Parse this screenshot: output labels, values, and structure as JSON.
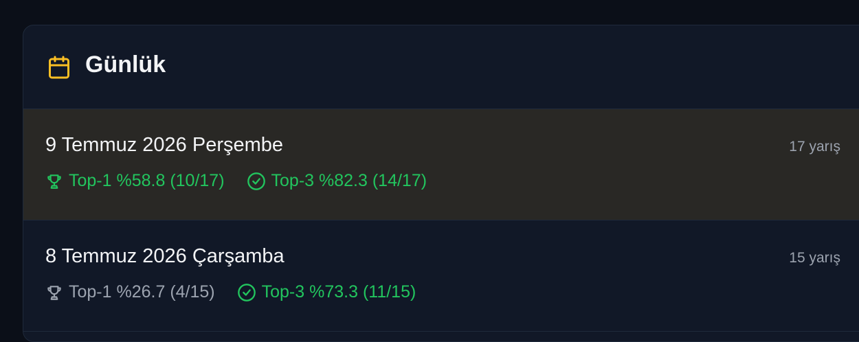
{
  "colors": {
    "accent": "#fbbf24",
    "success": "#22c55e",
    "muted": "#9ca3af",
    "highlight_row": "#292825",
    "card_bg": "#111827"
  },
  "header": {
    "icon": "calendar-icon",
    "title": "Günlük"
  },
  "days": [
    {
      "date": "9 Temmuz 2026 Perşembe",
      "count": "17 yarış",
      "top1": "Top-1 %58.8 (10/17)",
      "top3": "Top-3 %82.3 (14/17)",
      "top1_status": "success",
      "top3_status": "success",
      "highlighted": true
    },
    {
      "date": "8 Temmuz 2026 Çarşamba",
      "count": "15 yarış",
      "top1": "Top-1 %26.7 (4/15)",
      "top3": "Top-3 %73.3 (11/15)",
      "top1_status": "muted",
      "top3_status": "success",
      "highlighted": false
    }
  ]
}
